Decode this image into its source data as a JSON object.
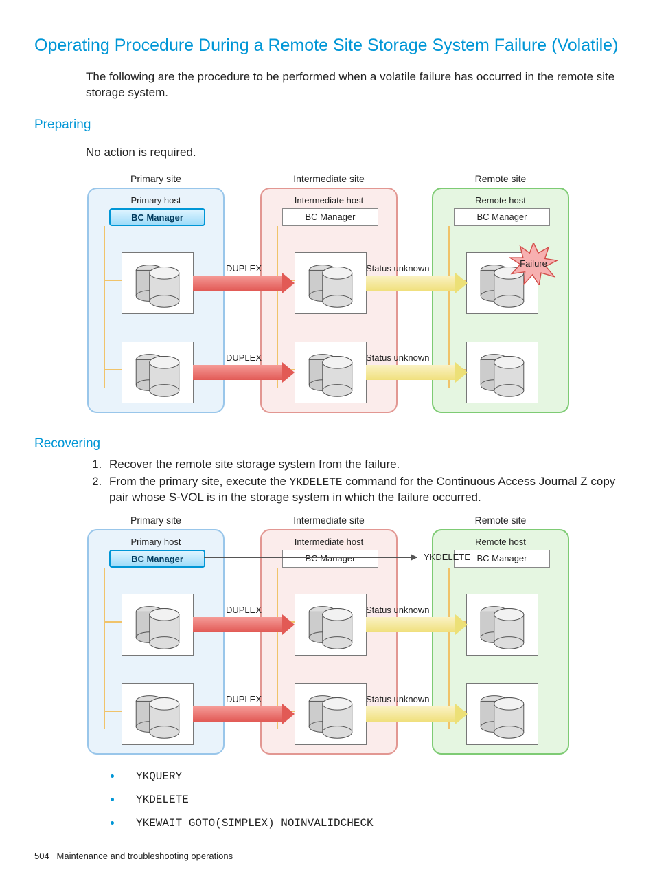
{
  "title": "Operating Procedure During a Remote Site Storage System Failure (Volatile)",
  "intro": "The following are the procedure to be performed when a volatile failure has occurred in the remote site storage system.",
  "preparing": {
    "heading": "Preparing",
    "text": "No action is required."
  },
  "recovering": {
    "heading": "Recovering",
    "steps": [
      "Recover the remote site storage system from the failure.",
      ""
    ],
    "step2_pre": "From the primary site, execute the ",
    "step2_code": "YKDELETE",
    "step2_post": " command for the Continuous Access Journal Z copy pair whose S-VOL is in the storage system in which the failure occurred."
  },
  "commands": {
    "c1": "YKQUERY",
    "c2": "YKDELETE",
    "c3": "YKEWAIT GOTO(SIMPLEX) NOINVALIDCHECK"
  },
  "footer": {
    "page": "504",
    "chapter": "Maintenance and troubleshooting operations"
  },
  "diagram": {
    "sites": {
      "primary": {
        "site": "Primary site",
        "host": "Primary host",
        "bc": "BC Manager"
      },
      "intermediate": {
        "site": "Intermediate site",
        "host": "Intermediate host",
        "bc": "BC Manager"
      },
      "remote": {
        "site": "Remote site",
        "host": "Remote host",
        "bc": "BC Manager"
      }
    },
    "labels": {
      "duplex": "DUPLEX",
      "status_unknown": "Status unknown",
      "failure": "Failure",
      "ykdelete": "YKDELETE"
    }
  }
}
